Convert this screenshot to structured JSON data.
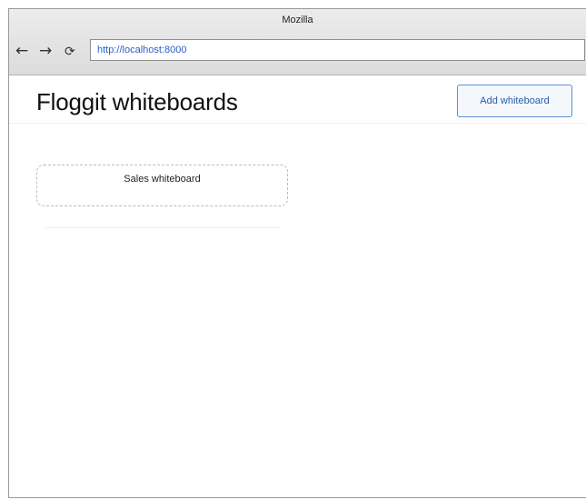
{
  "browser": {
    "window_title": "Mozilla",
    "url": "http://localhost:8000",
    "icons": {
      "back": "←",
      "forward": "→",
      "reload": "⟳"
    }
  },
  "page": {
    "title": "Floggit whiteboards",
    "add_button_label": "Add whiteboard",
    "whiteboards": [
      {
        "name": "Sales whiteboard"
      }
    ]
  }
}
